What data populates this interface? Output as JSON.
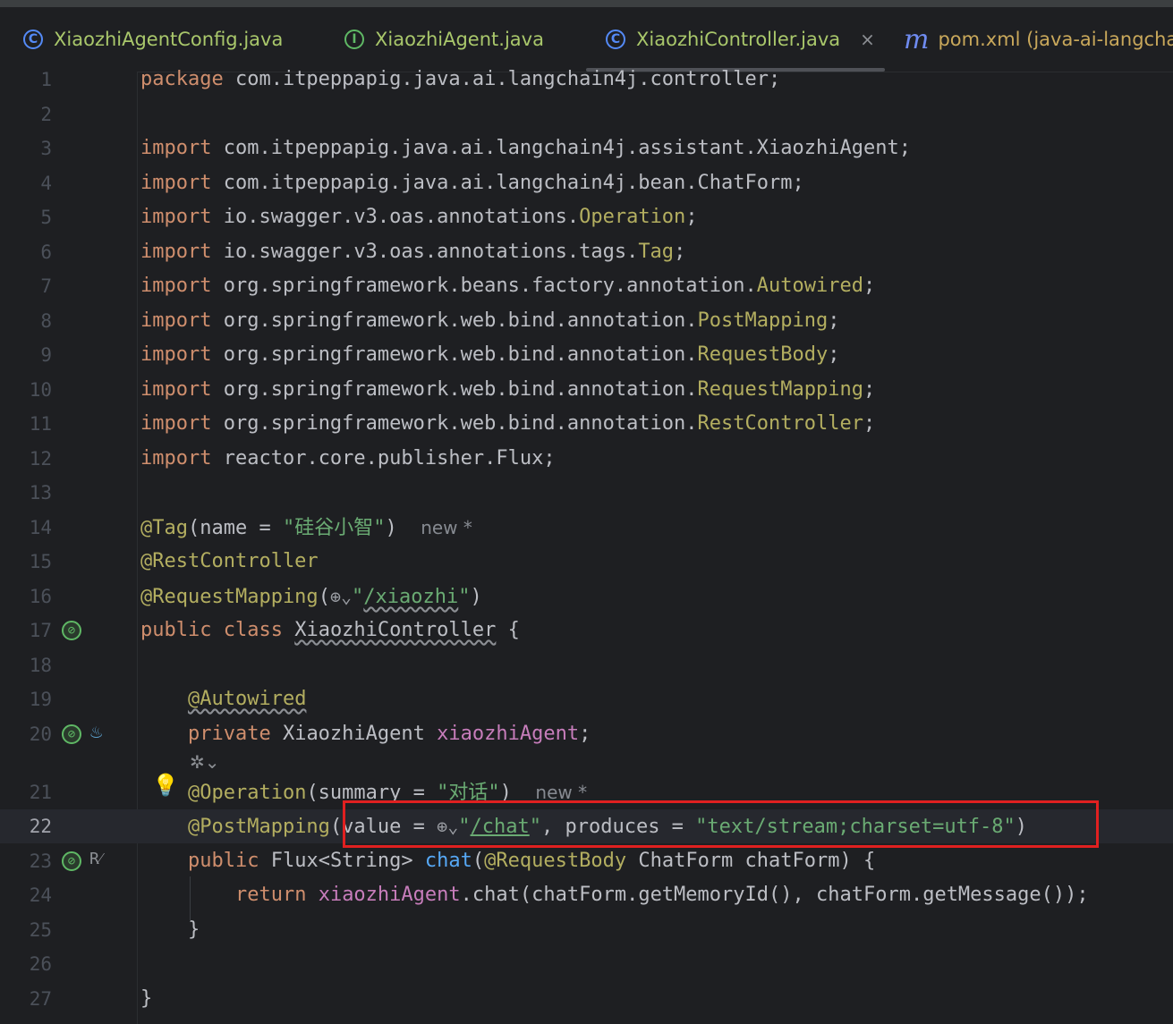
{
  "tabs": [
    {
      "label": "XiaozhiAgentConfig.java",
      "icon": "C"
    },
    {
      "label": "XiaozhiAgent.java",
      "icon": "I"
    },
    {
      "label": "XiaozhiController.java",
      "icon": "C",
      "close": "×"
    },
    {
      "label": "pom.xml (java-ai-langchai",
      "icon": "m"
    }
  ],
  "line_numbers": [
    "1",
    "2",
    "3",
    "4",
    "5",
    "6",
    "7",
    "8",
    "9",
    "10",
    "11",
    "12",
    "13",
    "14",
    "15",
    "16",
    "17",
    "18",
    "19",
    "20",
    "21",
    "22",
    "23",
    "24",
    "25",
    "26",
    "27"
  ],
  "code": {
    "l1": {
      "kw": "package",
      "rest": " com.itpeppapig.java.ai.langchain4j.controller;"
    },
    "l3": {
      "kw": "import",
      "rest": " com.itpeppapig.java.ai.langchain4j.assistant.XiaozhiAgent;"
    },
    "l4": {
      "kw": "import",
      "rest": " com.itpeppapig.java.ai.langchain4j.bean.ChatForm;"
    },
    "l5": {
      "kw": "import",
      "pkg": " io.swagger.v3.oas.annotations.",
      "ty": "Operation",
      "end": ";"
    },
    "l6": {
      "kw": "import",
      "pkg": " io.swagger.v3.oas.annotations.tags.",
      "ty": "Tag",
      "end": ";"
    },
    "l7": {
      "kw": "import",
      "pkg": " org.springframework.beans.factory.annotation.",
      "ty": "Autowired",
      "end": ";"
    },
    "l8": {
      "kw": "import",
      "pkg": " org.springframework.web.bind.annotation.",
      "ty": "PostMapping",
      "end": ";"
    },
    "l9": {
      "kw": "import",
      "pkg": " org.springframework.web.bind.annotation.",
      "ty": "RequestBody",
      "end": ";"
    },
    "l10": {
      "kw": "import",
      "pkg": " org.springframework.web.bind.annotation.",
      "ty": "RequestMapping",
      "end": ";"
    },
    "l11": {
      "kw": "import",
      "pkg": " org.springframework.web.bind.annotation.",
      "ty": "RestController",
      "end": ";"
    },
    "l12": {
      "kw": "import",
      "rest": " reactor.core.publisher.Flux;"
    },
    "l14": {
      "an": "@Tag",
      "open": "(name = ",
      "str": "\"硅谷小智\"",
      "close": ")",
      "hint": "new *"
    },
    "l15": {
      "an": "@RestController"
    },
    "l16": {
      "an": "@RequestMapping",
      "open": "(",
      "globe": "⊕⌄",
      "q1": "\"",
      "url": "/xiaozhi",
      "q2": "\"",
      "close": ")"
    },
    "l17": {
      "kw": "public class",
      "name": "XiaozhiController",
      "rest": " {"
    },
    "l19": {
      "an": "@Autowired"
    },
    "l20": {
      "kw": "private",
      "ty": " XiaozhiAgent ",
      "fld": "xiaozhiAgent",
      "end": ";"
    },
    "l21": {
      "an": "@Operation",
      "open": "(summary = ",
      "str": "\"对话\"",
      "close": ")",
      "hint": "new *"
    },
    "l22": {
      "an": "@PostMapping",
      "open": "(value = ",
      "globe": "⊕⌄",
      "q1": "\"",
      "url": "/chat",
      "q2": "\"",
      "mid": ", produces = ",
      "str": "\"text/stream;charset=utf-8\"",
      "close": ")"
    },
    "l23": {
      "kw": "public",
      "ty": " Flux<String> ",
      "fn": "chat",
      "open": "(",
      "an": "@RequestBody",
      "rest": " ChatForm chatForm) {"
    },
    "l24": {
      "kw": "return",
      "fld": " xiaozhiAgent",
      "rest": ".chat(chatForm.getMemoryId(), chatForm.getMessage());"
    },
    "l25": {
      "rest": "}"
    },
    "l27": {
      "rest": "}"
    }
  },
  "gutter_icons": {
    "bean": "⊘",
    "java": "♨",
    "bulb": "💡",
    "rr": "R⁄",
    "ai": "✲⌄"
  }
}
